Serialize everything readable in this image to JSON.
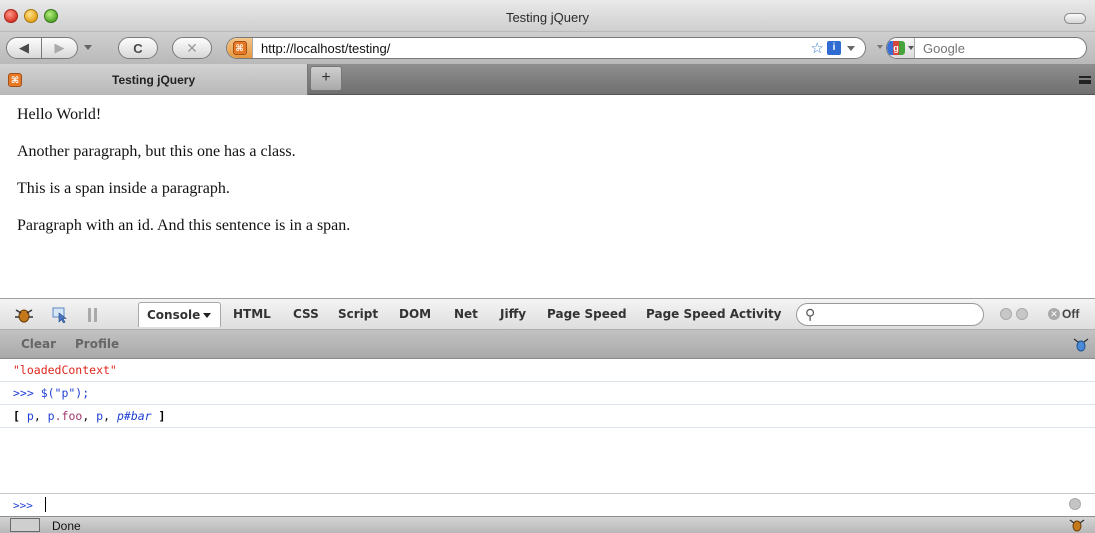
{
  "window": {
    "title": "Testing jQuery"
  },
  "navbar": {
    "url": "http://localhost/testing/",
    "search_placeholder": "Google",
    "favicon_glyph": "⌘"
  },
  "tabs": [
    {
      "label": "Testing jQuery"
    }
  ],
  "page": {
    "paragraphs": [
      "Hello World!",
      "Another paragraph, but this one has a class.",
      "This is a span inside a paragraph.",
      "Paragraph with an id. And this sentence is in a span."
    ]
  },
  "firebug": {
    "panels": [
      "Console",
      "HTML",
      "CSS",
      "Script",
      "DOM",
      "Net",
      "Jiffy",
      "Page Speed",
      "Page Speed Activity"
    ],
    "off_label": "Off",
    "subbar": {
      "clear": "Clear",
      "profile": "Profile"
    },
    "console": {
      "log_string": "\"loadedContext\"",
      "command": ">>> $(\"p\");",
      "result": {
        "open": "[",
        "items": [
          {
            "text": "p",
            "sep": ", "
          },
          {
            "text": "p.foo",
            "sep": ", "
          },
          {
            "text": "p",
            "sep": ", "
          },
          {
            "text": "p#bar",
            "sep": ""
          }
        ],
        "close": "]"
      },
      "prompt": ">>>"
    }
  },
  "status": {
    "text": "Done"
  },
  "colors": {
    "console_string": "#e0261c",
    "console_command": "#1f3fd6"
  }
}
